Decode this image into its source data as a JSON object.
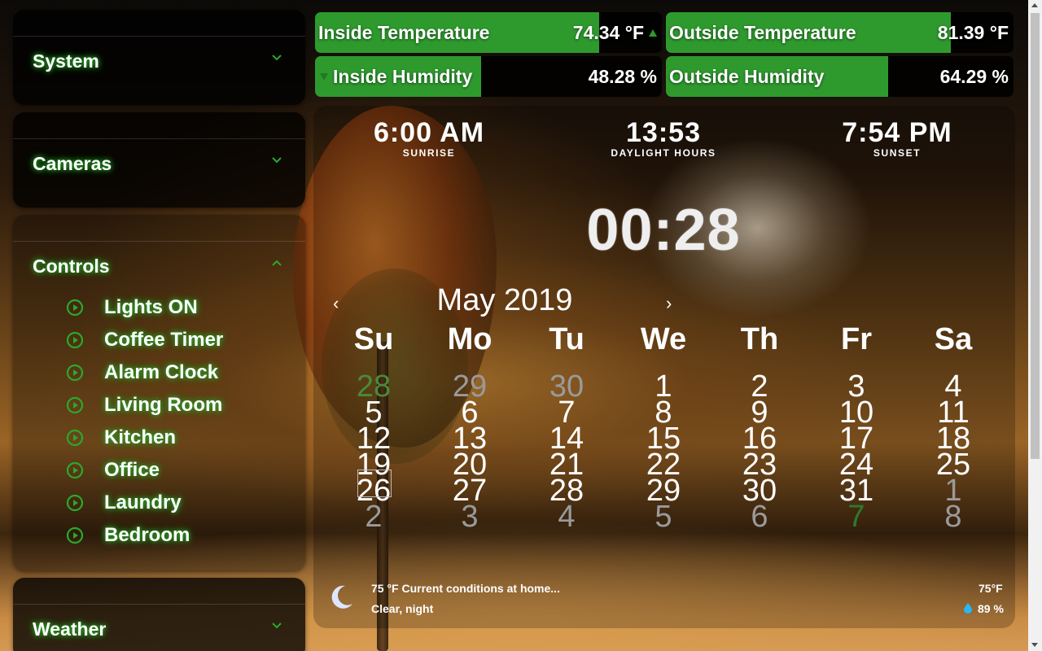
{
  "sidebar": {
    "sections": {
      "system": {
        "title": "System",
        "icon": "chevron-down-icon"
      },
      "cameras": {
        "title": "Cameras",
        "icon": "chevron-down-icon"
      },
      "controls": {
        "title": "Controls",
        "icon": "chevron-up-icon",
        "items": [
          {
            "label": "Lights ON",
            "icon": "play-circle-icon"
          },
          {
            "label": "Coffee Timer",
            "icon": "play-circle-icon"
          },
          {
            "label": "Alarm Clock",
            "icon": "play-circle-icon"
          },
          {
            "label": "Living Room",
            "icon": "play-circle-icon"
          },
          {
            "label": "Kitchen",
            "icon": "play-circle-icon"
          },
          {
            "label": "Office",
            "icon": "play-circle-icon"
          },
          {
            "label": "Laundry",
            "icon": "play-circle-icon"
          },
          {
            "label": "Bedroom",
            "icon": "play-circle-icon"
          }
        ]
      },
      "weather": {
        "title": "Weather",
        "icon": "chevron-down-icon"
      }
    }
  },
  "sensors": {
    "inside_temp": {
      "name": "Inside Temperature",
      "value": "74.34 °F",
      "level": 0.82,
      "trend": "up"
    },
    "outside_temp": {
      "name": "Outside Temperature",
      "value": "81.39 °F",
      "level": 0.82
    },
    "inside_humidity": {
      "name": "Inside Humidity",
      "value": "48.28 %",
      "level": 0.48,
      "trend": "down"
    },
    "outside_humidity": {
      "name": "Outside Humidity",
      "value": "64.29 %",
      "level": 0.64
    }
  },
  "sun": {
    "sunrise": {
      "time": "6:00 AM",
      "label": "SUNRISE"
    },
    "daylight": {
      "time": "13:53",
      "label": "DAYLIGHT HOURS"
    },
    "sunset": {
      "time": "7:54 PM",
      "label": "SUNSET"
    }
  },
  "clock": "00:28",
  "calendar": {
    "title": "May 2019",
    "prev": "‹",
    "next": "›",
    "weekdays": [
      "Su",
      "Mo",
      "Tu",
      "We",
      "Th",
      "Fr",
      "Sa"
    ],
    "weeks": [
      [
        "28",
        "29",
        "30",
        "1",
        "2",
        "3",
        "4"
      ],
      [
        "5",
        "6",
        "7",
        "8",
        "9",
        "10",
        "11"
      ],
      [
        "12",
        "13",
        "14",
        "15",
        "16",
        "17",
        "18"
      ],
      [
        "19",
        "20",
        "21",
        "22",
        "23",
        "24",
        "25"
      ],
      [
        "26",
        "27",
        "28",
        "29",
        "30",
        "31",
        "1"
      ],
      [
        "2",
        "3",
        "4",
        "5",
        "6",
        "7",
        "8"
      ]
    ],
    "today": "26"
  },
  "weather": {
    "summary": "75 °F Current conditions at home...",
    "condition": "Clear, night",
    "temperature": "75°F",
    "humidity": "89 %",
    "icon": "moon-icon"
  },
  "colors": {
    "accent_green": "#2e9a2e",
    "glow_green": "#2ba82b"
  }
}
